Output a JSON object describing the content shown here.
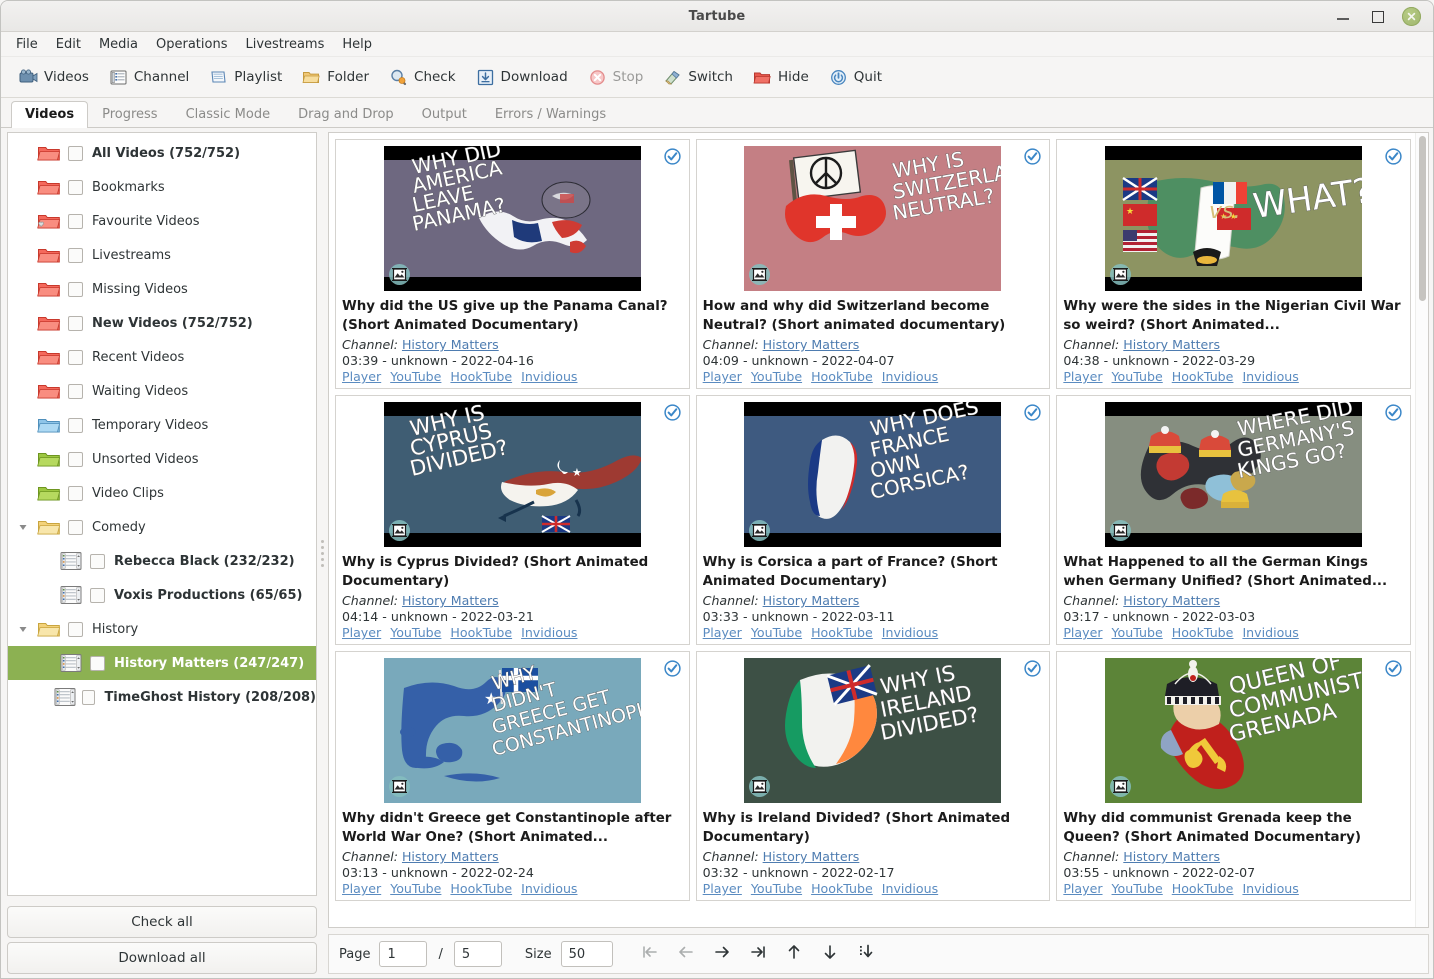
{
  "window": {
    "title": "Tartube",
    "controls": {
      "minimize": "minimize-button",
      "maximize": "maximize-button",
      "close": "close-button"
    }
  },
  "menubar": [
    "File",
    "Edit",
    "Media",
    "Operations",
    "Livestreams",
    "Help"
  ],
  "toolbar": [
    {
      "label": "Videos",
      "icon": "videos-icon",
      "disabled": false
    },
    {
      "label": "Channel",
      "icon": "channel-icon",
      "disabled": false
    },
    {
      "label": "Playlist",
      "icon": "playlist-icon",
      "disabled": false
    },
    {
      "label": "Folder",
      "icon": "folder-icon",
      "disabled": false
    },
    {
      "label": "Check",
      "icon": "check-icon",
      "disabled": false
    },
    {
      "label": "Download",
      "icon": "download-icon",
      "disabled": false
    },
    {
      "label": "Stop",
      "icon": "stop-icon",
      "disabled": true
    },
    {
      "label": "Switch",
      "icon": "switch-icon",
      "disabled": false
    },
    {
      "label": "Hide",
      "icon": "hide-icon",
      "disabled": false
    },
    {
      "label": "Quit",
      "icon": "quit-icon",
      "disabled": false
    }
  ],
  "tabs": [
    {
      "label": "Videos",
      "active": true
    },
    {
      "label": "Progress",
      "active": false
    },
    {
      "label": "Classic Mode",
      "active": false
    },
    {
      "label": "Drag and Drop",
      "active": false
    },
    {
      "label": "Output",
      "active": false
    },
    {
      "label": "Errors / Warnings",
      "active": false
    }
  ],
  "sidebar": {
    "items": [
      {
        "label": "All Videos (752/752)",
        "icon": "folder-red",
        "bold": true,
        "indent": 0,
        "expander": "none",
        "selected": false
      },
      {
        "label": "Bookmarks",
        "icon": "folder-red",
        "bold": false,
        "indent": 0,
        "expander": "none",
        "selected": false
      },
      {
        "label": "Favourite Videos",
        "icon": "folder-red-heart",
        "bold": false,
        "indent": 0,
        "expander": "none",
        "selected": false
      },
      {
        "label": "Livestreams",
        "icon": "folder-red",
        "bold": false,
        "indent": 0,
        "expander": "none",
        "selected": false
      },
      {
        "label": "Missing Videos",
        "icon": "folder-red",
        "bold": false,
        "indent": 0,
        "expander": "none",
        "selected": false
      },
      {
        "label": "New Videos (752/752)",
        "icon": "folder-red",
        "bold": true,
        "indent": 0,
        "expander": "none",
        "selected": false
      },
      {
        "label": "Recent Videos",
        "icon": "folder-red",
        "bold": false,
        "indent": 0,
        "expander": "none",
        "selected": false
      },
      {
        "label": "Waiting Videos",
        "icon": "folder-red",
        "bold": false,
        "indent": 0,
        "expander": "none",
        "selected": false
      },
      {
        "label": "Temporary Videos",
        "icon": "folder-blue",
        "bold": false,
        "indent": 0,
        "expander": "none",
        "selected": false
      },
      {
        "label": "Unsorted Videos",
        "icon": "folder-green",
        "bold": false,
        "indent": 0,
        "expander": "none",
        "selected": false
      },
      {
        "label": "Video Clips",
        "icon": "folder-green",
        "bold": false,
        "indent": 0,
        "expander": "none",
        "selected": false
      },
      {
        "label": "Comedy",
        "icon": "folder-yellow",
        "bold": false,
        "indent": 0,
        "expander": "down",
        "selected": false
      },
      {
        "label": "Rebecca Black (232/232)",
        "icon": "channel-list",
        "bold": true,
        "indent": 1,
        "expander": "none",
        "selected": false
      },
      {
        "label": "Voxis Productions (65/65)",
        "icon": "channel-list",
        "bold": true,
        "indent": 1,
        "expander": "none",
        "selected": false
      },
      {
        "label": "History",
        "icon": "folder-yellow",
        "bold": false,
        "indent": 0,
        "expander": "down",
        "selected": false
      },
      {
        "label": "History Matters (247/247)",
        "icon": "channel-list",
        "bold": true,
        "indent": 1,
        "expander": "none",
        "selected": true
      },
      {
        "label": "TimeGhost History (208/208)",
        "icon": "channel-list",
        "bold": true,
        "indent": 1,
        "expander": "none",
        "selected": false
      }
    ],
    "check_all_label": "Check all",
    "download_all_label": "Download all"
  },
  "catalog": {
    "channel_label": "Channel:",
    "link_labels": [
      "Player",
      "YouTube",
      "HookTube",
      "Invidious"
    ],
    "videos": [
      {
        "title": "Why did the US give up the Panama Canal? (Short Animated Documentary)",
        "channel": "History Matters",
        "duration": "03:39",
        "size": "unknown",
        "date": "2022-04-16",
        "checked": true,
        "thumb": {
          "bg": "#6e6880",
          "text": [
            "WHY DID",
            "AMERICA",
            "LEAVE",
            "PANAMA?"
          ],
          "bars": true,
          "shape": "panama"
        }
      },
      {
        "title": "How and why did Switzerland become Neutral? (Short animated documentary)",
        "channel": "History Matters",
        "duration": "04:09",
        "size": "unknown",
        "date": "2022-04-07",
        "checked": true,
        "thumb": {
          "bg": "#c47f84",
          "text": [
            "WHY IS",
            "SWITZERLAND",
            "NEUTRAL?"
          ],
          "bars": false,
          "shape": "swiss"
        }
      },
      {
        "title": "Why were the sides in the Nigerian Civil War so weird? (Short Animated...",
        "channel": "History Matters",
        "duration": "04:38",
        "size": "unknown",
        "date": "2022-03-29",
        "checked": true,
        "thumb": {
          "bg": "#8d9462",
          "text": [
            "WHAT?"
          ],
          "bars": true,
          "shape": "nigeria"
        }
      },
      {
        "title": "Why is Cyprus Divided? (Short Animated Documentary)",
        "channel": "History Matters",
        "duration": "04:14",
        "size": "unknown",
        "date": "2022-03-21",
        "checked": true,
        "thumb": {
          "bg": "#3f5d73",
          "text": [
            "WHY IS",
            "CYPRUS",
            "DIVIDED?"
          ],
          "bars": true,
          "shape": "cyprus"
        }
      },
      {
        "title": "Why is Corsica a part of France? (Short Animated Documentary)",
        "channel": "History Matters",
        "duration": "03:33",
        "size": "unknown",
        "date": "2022-03-11",
        "checked": true,
        "thumb": {
          "bg": "#3e5a80",
          "text": [
            "WHY DOES",
            "FRANCE",
            "OWN",
            "CORSICA?"
          ],
          "bars": true,
          "shape": "corsica"
        }
      },
      {
        "title": "What Happened to all the German Kings when Germany Unified? (Short Animated...",
        "channel": "History Matters",
        "duration": "03:17",
        "size": "unknown",
        "date": "2022-03-03",
        "checked": true,
        "thumb": {
          "bg": "#868e80",
          "text": [
            "WHERE DID",
            "GERMANY'S",
            "KINGS GO?"
          ],
          "bars": true,
          "shape": "germany"
        }
      },
      {
        "title": "Why didn't Greece get Constantinople after World War One? (Short Animated...",
        "channel": "History Matters",
        "duration": "03:13",
        "size": "unknown",
        "date": "2022-02-24",
        "checked": true,
        "thumb": {
          "bg": "#79a9bb",
          "text": [
            "WHY",
            "DIDN'T",
            "GREECE GET",
            "CONSTANTINOPLE?"
          ],
          "bars": false,
          "shape": "greece"
        }
      },
      {
        "title": "Why is Ireland Divided? (Short Animated Documentary)",
        "channel": "History Matters",
        "duration": "03:32",
        "size": "unknown",
        "date": "2022-02-17",
        "checked": true,
        "thumb": {
          "bg": "#3d5045",
          "text": [
            "WHY IS",
            "IRELAND",
            "DIVIDED?"
          ],
          "bars": false,
          "shape": "ireland"
        }
      },
      {
        "title": "Why did communist Grenada keep the Queen? (Short Animated Documentary)",
        "channel": "History Matters",
        "duration": "03:55",
        "size": "unknown",
        "date": "2022-02-07",
        "checked": true,
        "thumb": {
          "bg": "#5c8438",
          "text": [
            "QUEEN OF",
            "COMMUNIST",
            "GRENADA"
          ],
          "bars": false,
          "shape": "grenada"
        }
      }
    ]
  },
  "pagination": {
    "page_label": "Page",
    "page_value": "1",
    "separator": "/",
    "total_pages": "5",
    "size_label": "Size",
    "size_value": "50",
    "buttons": [
      {
        "name": "first-page-button",
        "icon": "first-arrow",
        "disabled": true
      },
      {
        "name": "previous-page-button",
        "icon": "left-arrow",
        "disabled": true
      },
      {
        "name": "next-page-button",
        "icon": "right-arrow",
        "disabled": false
      },
      {
        "name": "last-page-button",
        "icon": "last-arrow",
        "disabled": false
      },
      {
        "name": "scroll-up-button",
        "icon": "up-arrow",
        "disabled": false
      },
      {
        "name": "scroll-down-button",
        "icon": "down-arrow",
        "disabled": false
      },
      {
        "name": "jump-bottom-button",
        "icon": "jump-down-arrow",
        "disabled": false
      }
    ]
  },
  "colors": {
    "selection": "#8cb152",
    "link": "#4e7cb0",
    "check": "#3b87c8"
  }
}
